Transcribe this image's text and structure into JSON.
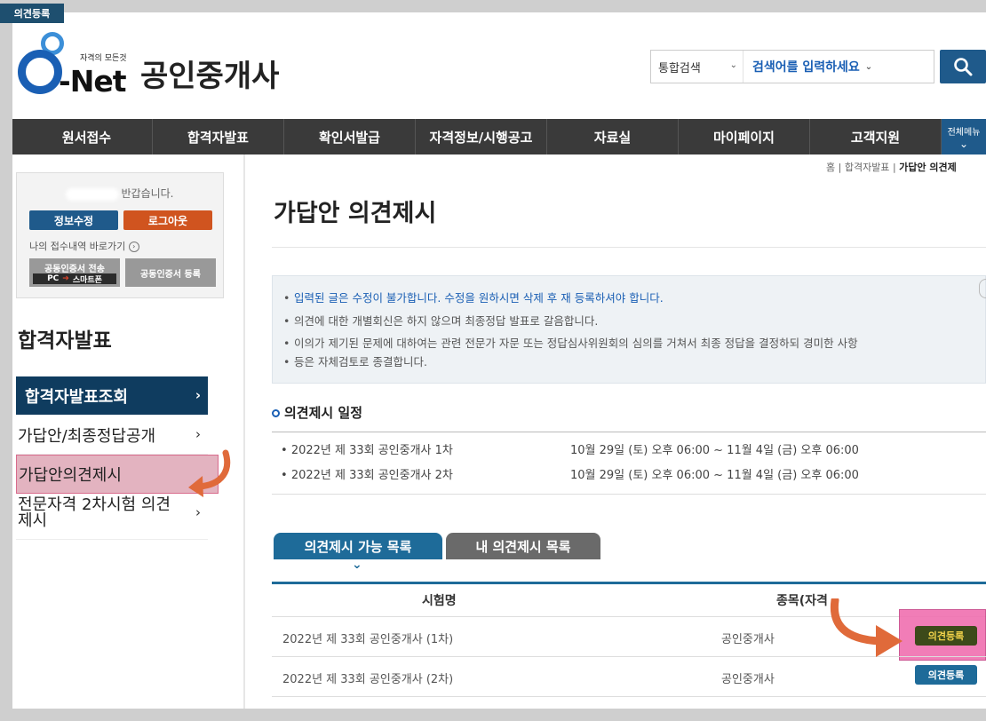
{
  "corner_label": "의견등록",
  "header": {
    "logo_tagline": "자격의 모든것",
    "logo_text": "-Net",
    "site_title": "공인중개사",
    "search_scope": "통합검색",
    "search_placeholder": "검색어를 입력하세요"
  },
  "nav": {
    "items": [
      "원서접수",
      "합격자발표",
      "확인서발급",
      "자격정보/시행공고",
      "자료실",
      "마이페이지",
      "고객지원"
    ],
    "all_menu_label": "전체메뉴"
  },
  "login_box": {
    "greeting": "반갑습니다.",
    "edit_label": "정보수정",
    "logout_label": "로그아웃",
    "my_applications": "나의 접수내역 바로가기",
    "cert_send_label": "공동인증서 전송",
    "cert_send_sub_pc": "PC",
    "cert_send_sub_phone": "스마트폰",
    "cert_register_label": "공동인증서 등록"
  },
  "sidebar": {
    "title": "합격자발표",
    "items": [
      {
        "label": "합격자발표조회"
      },
      {
        "label": "가답안/최종정답공개"
      },
      {
        "label": "가답안의견제시"
      },
      {
        "label": "전문자격 2차시험 의견제시"
      }
    ]
  },
  "breadcrumb": {
    "home": "홈",
    "parent": "합격자발표",
    "current": "가답안 의견제"
  },
  "page_title": "가답안 의견제시",
  "notices": [
    "입력된 글은 수정이 불가합니다. 수정을 원하시면 삭제 후 재 등록하셔야 합니다.",
    "의견에 대한 개별회신은 하지 않으며 최종정답 발표로 갈음합니다.",
    "이의가 제기된 문제에 대하여는 관련 전문가 자문 또는 정답심사위원회의 심의를 거쳐서 최종 정답을 결정하되 경미한 사항",
    "등은 자체검토로 종결합니다."
  ],
  "schedule": {
    "title": "의견제시 일정",
    "rows": [
      {
        "exam": "2022년 제 33회 공인중개사 1차",
        "period": "10월 29일 (토) 오후 06:00 ~ 11월 4일 (금) 오후 06:00"
      },
      {
        "exam": "2022년 제 33회 공인중개사 2차",
        "period": "10월 29일 (토) 오후 06:00 ~ 11월 4일 (금) 오후 06:00"
      }
    ]
  },
  "tabs": [
    "의견제시 가능 목록",
    "내 의견제시 목록"
  ],
  "table": {
    "headers": [
      "시험명",
      "종목(자격"
    ],
    "rows": [
      {
        "exam": "2022년 제 33회 공인중개사 (1차)",
        "category": "공인중개사",
        "action": "의견등록"
      },
      {
        "exam": "2022년 제 33회 공인중개사 (2차)",
        "category": "공인중개사",
        "action": "의견등록"
      }
    ]
  },
  "colors": {
    "brand_blue": "#1f5a8b",
    "accent_orange": "#d0541f",
    "active_nav": "#0f3c5f",
    "highlight_pink": "#e3b3c0"
  }
}
